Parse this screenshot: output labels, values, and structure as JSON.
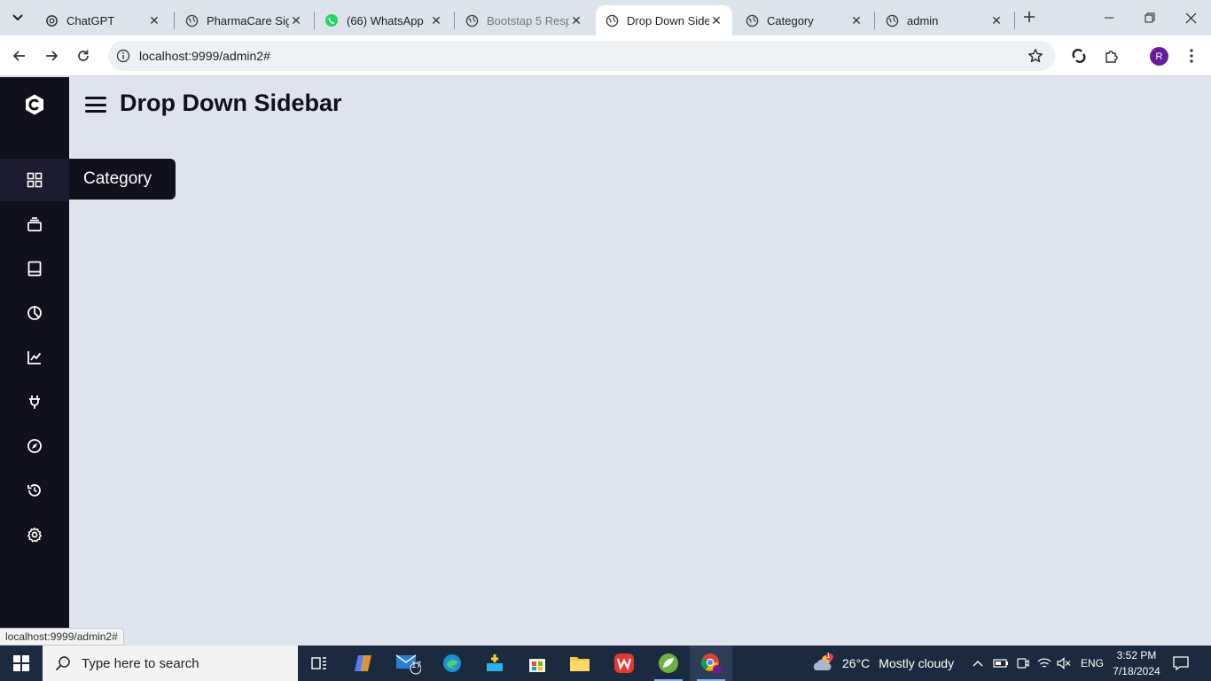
{
  "browser": {
    "tabs": [
      {
        "title": "ChatGPT",
        "active": false,
        "icon": "chatgpt-icon"
      },
      {
        "title": "PharmaCare Sig",
        "active": false,
        "icon": "globe-icon"
      },
      {
        "title": "(66) WhatsApp",
        "active": false,
        "icon": "whatsapp-icon"
      },
      {
        "title": "Bootstap 5 Resp",
        "active": false,
        "icon": "globe-icon"
      },
      {
        "title": "Drop Down Side",
        "active": true,
        "icon": "globe-icon"
      },
      {
        "title": "Category",
        "active": false,
        "icon": "globe-icon"
      },
      {
        "title": "admin",
        "active": false,
        "icon": "globe-icon"
      }
    ],
    "url": "localhost:9999/admin2#",
    "profile_initial": "R"
  },
  "page": {
    "title": "Drop Down Sidebar",
    "tooltip": "Category",
    "sidebar_items": [
      {
        "icon": "grid-icon",
        "label": "Category",
        "active": true
      },
      {
        "icon": "layers-icon"
      },
      {
        "icon": "book-icon"
      },
      {
        "icon": "pie-chart-icon"
      },
      {
        "icon": "line-chart-icon"
      },
      {
        "icon": "plug-icon"
      },
      {
        "icon": "compass-icon"
      },
      {
        "icon": "history-icon"
      },
      {
        "icon": "gear-icon"
      }
    ],
    "status_url": "localhost:9999/admin2#"
  },
  "taskbar": {
    "search_placeholder": "Type here to search",
    "mail_badge": "17",
    "weather_badge": "1",
    "temperature": "26°C",
    "weather": "Mostly cloudy",
    "language": "ENG",
    "time": "3:52 PM",
    "date": "7/18/2024"
  },
  "colors": {
    "sidebar_bg": "#11101d",
    "page_bg": "#dfe3ee",
    "tab_strip": "#dde3ea"
  }
}
